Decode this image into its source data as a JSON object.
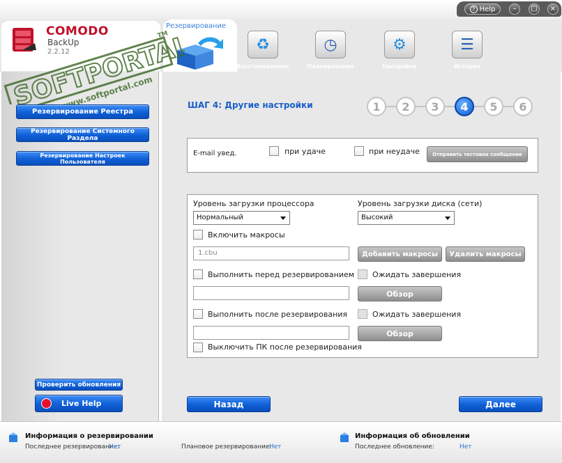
{
  "window": {
    "help_label": "Help",
    "minimize_symbol": "–",
    "maximize_symbol": "□",
    "close_symbol": "×"
  },
  "logo": {
    "brand": "COMODO",
    "product": "BackUp",
    "version": "2.2.12"
  },
  "toolbar": {
    "active_tab": "Резервирование",
    "items": [
      {
        "label": "Восстановление",
        "icon": "recycle-icon",
        "glyph": "♻"
      },
      {
        "label": "Планирование",
        "icon": "clock-icon",
        "glyph": "◷"
      },
      {
        "label": "Настройки",
        "icon": "tools-icon",
        "glyph": "⚙"
      },
      {
        "label": "История",
        "icon": "history-icon",
        "glyph": "☰"
      }
    ]
  },
  "left": {
    "buttons": [
      "Резервирование Реестра",
      "Резервирование Системного Раздела",
      "Резервирование Настроек Пользователя"
    ],
    "update_button": "Проверить обновления",
    "live_help": "Live Help"
  },
  "step": {
    "title": "ШАГ 4: Другие настройки",
    "numbers": [
      "1",
      "2",
      "3",
      "4",
      "5",
      "6"
    ],
    "current": 4
  },
  "email": {
    "label": "E-mail увед.",
    "on_success": "при удаче",
    "on_failure": "при неудаче",
    "test_button": "Отправить тестовое сообщение"
  },
  "settings": {
    "cpu_label": "Уровень загрузки процессора",
    "cpu_value": "Нормальный",
    "disk_label": "Уровень загрузки диска (сети)",
    "disk_value": "Высокий",
    "enable_macros": "Включить макросы",
    "macro_input_value": "1.cbu",
    "add_macros": "Добавить макросы",
    "remove_macros": "Удалить макросы",
    "run_before": "Выполнить перед резервированием",
    "wait_finish_1": "Ожидать завершения",
    "browse_1": "Обзор",
    "run_after": "Выполнить после резервирования",
    "wait_finish_2": "Ожидать завершения",
    "browse_2": "Обзор",
    "shutdown": "Выключить ПК после резервирования"
  },
  "nav": {
    "back": "Назад",
    "next": "Далее"
  },
  "footer": {
    "backup_info_title": "Информация о резервировании",
    "last_backup_label": "Последнее резервирование:",
    "last_backup_value": "Нет",
    "planned_backup_label": "Плановое резервирование:",
    "planned_backup_value": "Нет",
    "update_info_title": "Информация об обновлении",
    "last_update_label": "Последнее обновление:",
    "last_update_value": "Нет"
  },
  "watermark": {
    "text": "SOFTPORTAL",
    "url": "www.softportal.com",
    "tm": "TM"
  },
  "colors": {
    "accent_blue": "#0f5fd6",
    "panel_gray": "#e8e8e8",
    "brand_red": "#c0102a",
    "link_blue": "#2a6fd6"
  }
}
